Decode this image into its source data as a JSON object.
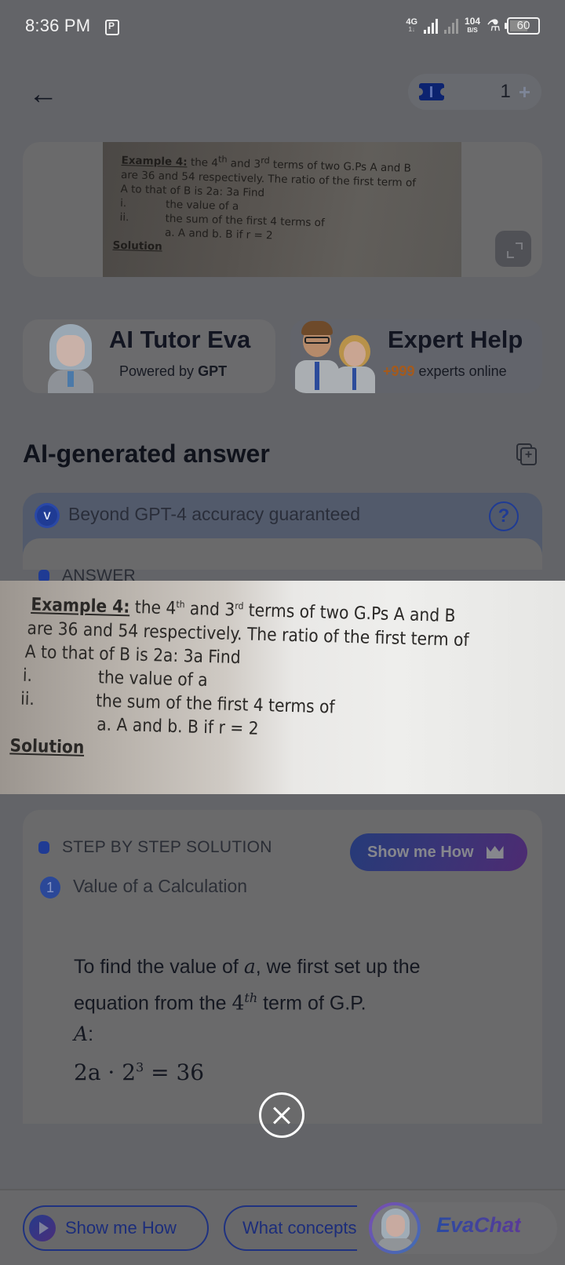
{
  "status_bar": {
    "time": "8:36 PM",
    "network": "4G",
    "network_sub": "1↓",
    "speed_value": "104",
    "speed_unit": "B/S",
    "battery": "60"
  },
  "header": {
    "back_icon": "arrow-left-icon",
    "credit_icon": "ticket-icon",
    "credit_count": "1",
    "credit_add": "+"
  },
  "question": {
    "label": "Example 4:",
    "line1_rest": " the 4",
    "sup1": "th",
    "line1_mid": " and 3",
    "sup2": "rd",
    "line1_end": " terms of two G.Ps  A and B",
    "line2": "are 36 and 54 respectively. The ratio of the first term of",
    "line3": "A to that of B is 2a: 3a Find",
    "items": [
      {
        "num": "i.",
        "text": "the value of a"
      },
      {
        "num": "ii.",
        "text": "the sum of the first 4 terms of"
      }
    ],
    "sub_items": "a. A and  b. B if r = 2",
    "solution_label": "Solution",
    "expand_icon": "expand-icon"
  },
  "tutor_cards": {
    "ai_tutor": {
      "title": "AI Tutor Eva",
      "sub_prefix": "Powered by ",
      "sub_bold": "GPT"
    },
    "expert": {
      "title": "Expert Help",
      "count": "+999",
      "sub": " experts online"
    }
  },
  "answer": {
    "title": "AI-generated answer",
    "copy_icon": "copy-add-icon",
    "accuracy_badge": "V",
    "accuracy_text": "Beyond GPT-4 accuracy guaranteed",
    "help_icon": "?",
    "answer_label": "ANSWER"
  },
  "solution": {
    "section_label": "STEP BY STEP SOLUTION",
    "show_how_label": "Show me How",
    "step_number": "1",
    "step_title": "Value of a Calculation",
    "body_1": "To find the value of ",
    "body_var_a": "a",
    "body_2": ", we first set up the equation from the ",
    "body_4": "4",
    "body_th": "th",
    "body_3": " term of G.P. ",
    "body_var_A": "A",
    "body_colon": ":",
    "equation_lhs": "2a · 2",
    "equation_exp": "3",
    "equation_rhs": " = 36"
  },
  "bottom_bar": {
    "chip_show_how": "Show me How",
    "chip_concepts": "What concepts",
    "evachat_label": "EvaChat"
  },
  "colors": {
    "accent_blue": "#1f3b94",
    "expert_count": "#a55a1c",
    "overlay_bg": "#636468"
  }
}
